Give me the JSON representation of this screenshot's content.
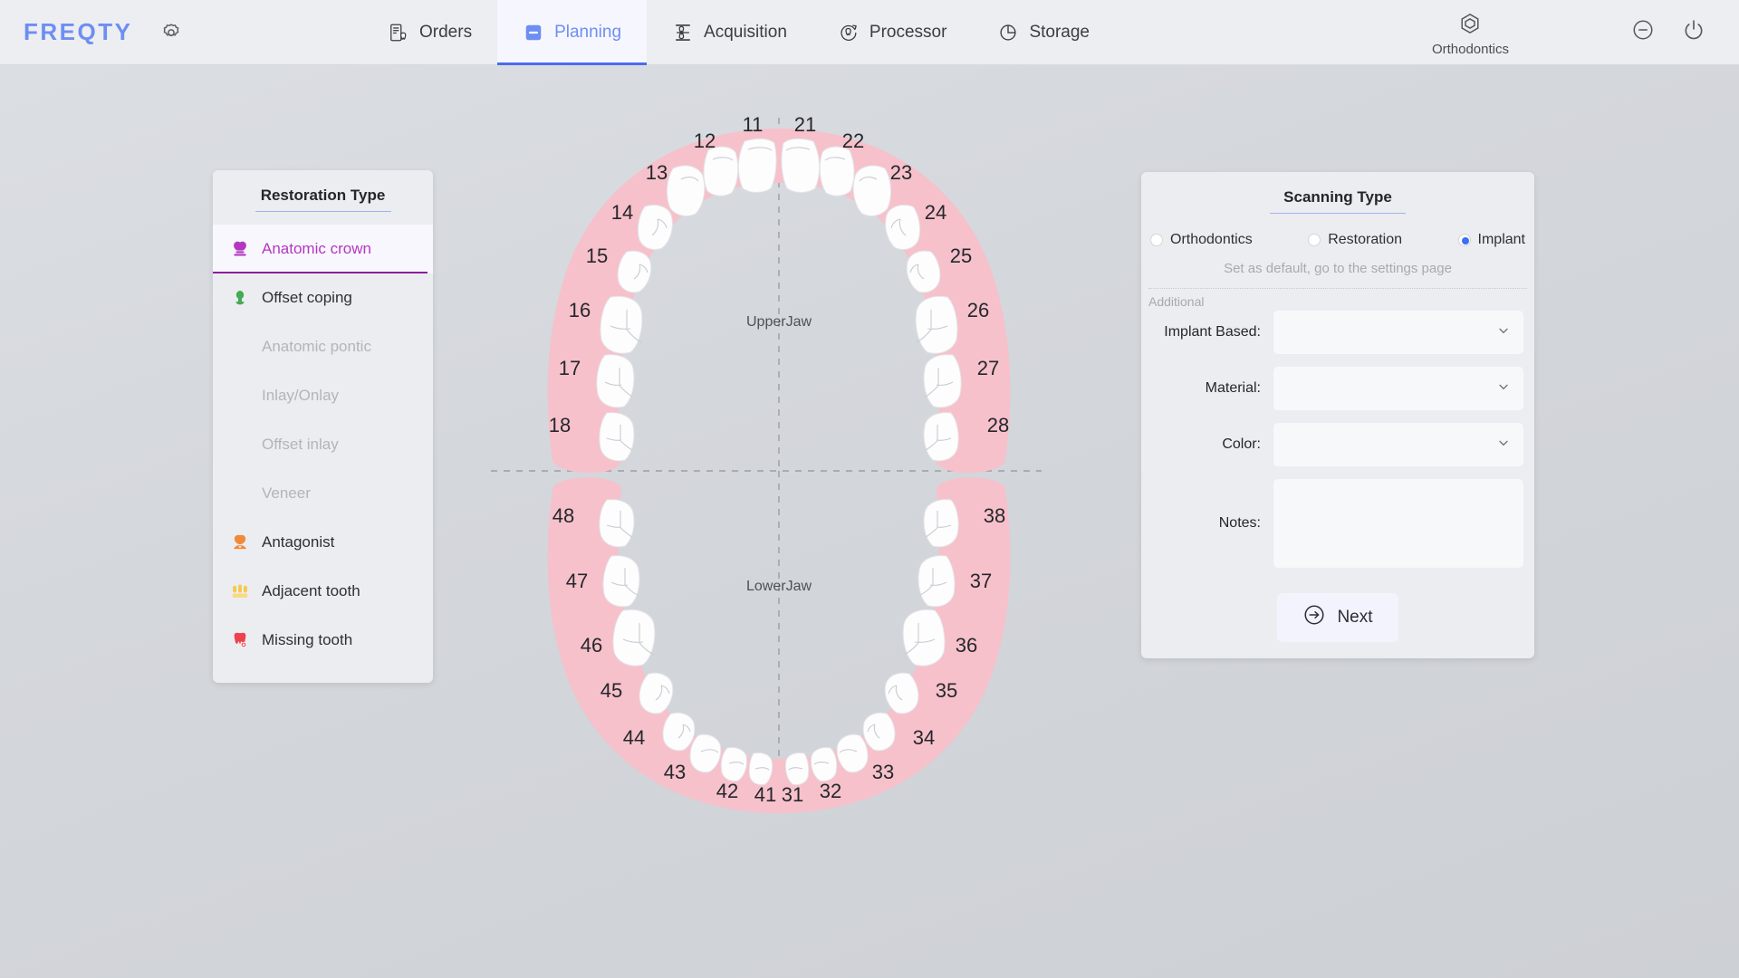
{
  "header": {
    "logo": "FREQTY",
    "settings_icon": "gear-icon",
    "tabs": [
      {
        "label": "Orders",
        "icon": "orders-document-tooth-icon",
        "active": false
      },
      {
        "label": "Planning",
        "icon": "planning-panel-icon",
        "active": true
      },
      {
        "label": "Acquisition",
        "icon": "acquisition-scan-icon",
        "active": false
      },
      {
        "label": "Processor",
        "icon": "processor-tooth-refresh-icon",
        "active": false
      },
      {
        "label": "Storage",
        "icon": "storage-pie-icon",
        "active": false
      }
    ],
    "mode": {
      "label": "Orthodontics",
      "icon": "hexagon-target-icon"
    },
    "window_controls": [
      {
        "name": "minimize-button",
        "icon": "minimize-circle-icon"
      },
      {
        "name": "power-button",
        "icon": "power-icon"
      }
    ],
    "accent_color": "#6e8ef2",
    "active_tab_bg": "#f6f7fe"
  },
  "restoration_panel": {
    "title": "Restoration Type",
    "items": [
      {
        "label": "Anatomic crown",
        "icon": "crown-tooth-icon",
        "color": "#b437c2",
        "state": "selected"
      },
      {
        "label": "Offset coping",
        "icon": "coping-tooth-icon",
        "color": "#44aa55",
        "state": "enabled"
      },
      {
        "label": "Anatomic pontic",
        "icon": "pontic-tooth-icon",
        "color": "#b2b5ba",
        "state": "disabled"
      },
      {
        "label": "Inlay/Onlay",
        "icon": "inlay-tooth-icon",
        "color": "#b2b5ba",
        "state": "disabled"
      },
      {
        "label": "Offset inlay",
        "icon": "offset-inlay-tooth-icon",
        "color": "#b2b5ba",
        "state": "disabled"
      },
      {
        "label": "Veneer",
        "icon": "veneer-tooth-icon",
        "color": "#b2b5ba",
        "state": "disabled"
      },
      {
        "label": "Antagonist",
        "icon": "antagonist-tooth-icon",
        "color": "#f08a3c",
        "state": "enabled"
      },
      {
        "label": "Adjacent tooth",
        "icon": "adjacent-tooth-icon",
        "color": "#f7c948",
        "state": "enabled"
      },
      {
        "label": "Missing tooth",
        "icon": "missing-tooth-icon",
        "color": "#f0404b",
        "state": "enabled"
      }
    ]
  },
  "scanning_panel": {
    "title": "Scanning Type",
    "radios": [
      {
        "label": "Orthodontics",
        "checked": false
      },
      {
        "label": "Restoration",
        "checked": false
      },
      {
        "label": "Implant",
        "checked": true
      }
    ],
    "hint": "Set as default, go to the settings page",
    "additional_label": "Additional",
    "fields": [
      {
        "label": "Implant Based:",
        "type": "select",
        "value": "",
        "icon": "chevron-down-icon"
      },
      {
        "label": "Material:",
        "type": "select",
        "value": "",
        "icon": "chevron-down-icon"
      },
      {
        "label": "Color:",
        "type": "select",
        "value": "",
        "icon": "chevron-down-icon"
      }
    ],
    "notes": {
      "label": "Notes:",
      "value": ""
    },
    "next_button": {
      "label": "Next",
      "icon": "arrow-right-circle-icon"
    },
    "selected_radio_color": "#3d6ef5"
  },
  "dental_chart": {
    "upper_jaw_label": "UpperJaw",
    "lower_jaw_label": "LowerJaw",
    "gum_color": "#f6c1cb",
    "tooth_color": "#fdfdfd",
    "upper_left_quadrant": [
      "11",
      "12",
      "13",
      "14",
      "15",
      "16",
      "17",
      "18"
    ],
    "upper_right_quadrant": [
      "21",
      "22",
      "23",
      "24",
      "25",
      "26",
      "27",
      "28"
    ],
    "lower_left_quadrant": [
      "41",
      "42",
      "43",
      "44",
      "45",
      "46",
      "47",
      "48"
    ],
    "lower_right_quadrant": [
      "31",
      "32",
      "33",
      "34",
      "35",
      "36",
      "37",
      "38"
    ],
    "upper_numbers_ordered": [
      "18",
      "17",
      "16",
      "15",
      "14",
      "13",
      "12",
      "11",
      "21",
      "22",
      "23",
      "24",
      "25",
      "26",
      "27",
      "28"
    ],
    "lower_numbers_ordered": [
      "48",
      "47",
      "46",
      "45",
      "44",
      "43",
      "42",
      "41",
      "31",
      "32",
      "33",
      "34",
      "35",
      "36",
      "37",
      "38"
    ]
  }
}
